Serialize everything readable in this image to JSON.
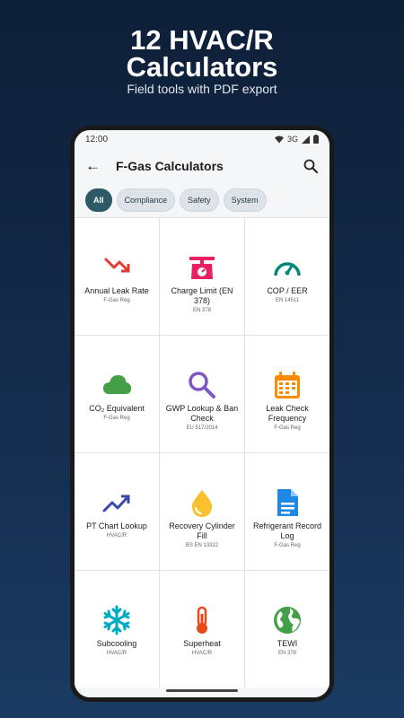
{
  "promo": {
    "title_line1": "12 HVAC/R",
    "title_line2": "Calculators",
    "subtitle": "Field tools with PDF export"
  },
  "status_bar": {
    "time": "12:00",
    "network": "3G"
  },
  "app_bar": {
    "title": "F-Gas Calculators"
  },
  "chips": [
    "All",
    "Compliance",
    "Safety",
    "System"
  ],
  "active_chip": "All",
  "calculators": [
    {
      "label": "Annual Leak Rate",
      "sub": "F-Gas Reg",
      "icon": "trending-down-icon",
      "color": "#e53935"
    },
    {
      "label": "Charge Limit (EN 378)",
      "sub": "EN 378",
      "icon": "scale-icon",
      "color": "#e91e63"
    },
    {
      "label": "COP / EER",
      "sub": "EN 14511",
      "icon": "gauge-icon",
      "color": "#00897b"
    },
    {
      "label": "CO₂ Equivalent",
      "sub": "F-Gas Reg",
      "icon": "cloud-icon",
      "color": "#43a047"
    },
    {
      "label": "GWP Lookup & Ban Check",
      "sub": "EU 517/2014",
      "icon": "magnifier-icon",
      "color": "#7e57c2"
    },
    {
      "label": "Leak Check Frequency",
      "sub": "F-Gas Reg",
      "icon": "calendar-icon",
      "color": "#fb8c00"
    },
    {
      "label": "PT Chart Lookup",
      "sub": "HVAC/R",
      "icon": "trending-up-icon",
      "color": "#3949ab"
    },
    {
      "label": "Recovery Cylinder Fill",
      "sub": "BS EN 13322",
      "icon": "drop-icon",
      "color": "#fbc02d"
    },
    {
      "label": "Refrigerant Record Log",
      "sub": "F-Gas Reg",
      "icon": "document-icon",
      "color": "#1e88e5"
    },
    {
      "label": "Subcooling",
      "sub": "HVAC/R",
      "icon": "snowflake-icon",
      "color": "#00acc1"
    },
    {
      "label": "Superheat",
      "sub": "HVAC/R",
      "icon": "thermometer-icon",
      "color": "#e64a19"
    },
    {
      "label": "TEWI",
      "sub": "EN 378",
      "icon": "globe-icon",
      "color": "#43a047"
    }
  ]
}
